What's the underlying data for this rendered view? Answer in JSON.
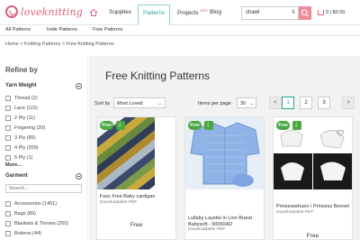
{
  "header": {
    "logo_text": "loveknitting",
    "nav": [
      "Supplies",
      "Patterns",
      "Projects",
      "Blog"
    ],
    "projects_badge": "NEW",
    "search_value": "shawl",
    "cart_text": "0 | $0.00",
    "brand_color": "#e0607e",
    "accent_color": "#2aa198"
  },
  "subnav": [
    "All Patterns",
    "Indie Patterns",
    "Free Patterns"
  ],
  "breadcrumb": "Home > Knitting Patterns > Free Knitting Patterns",
  "sidebar": {
    "refine_label": "Refine by",
    "yarn_weight_title": "Yarn Weight",
    "yarn_weights": [
      {
        "label": "Thread (2)"
      },
      {
        "label": "Lace (115)"
      },
      {
        "label": "2 Ply (11)"
      },
      {
        "label": "Fingering (20)"
      },
      {
        "label": "3 Ply (85)"
      },
      {
        "label": "4 Ply (209)"
      },
      {
        "label": "5 Ply (1)"
      }
    ],
    "more_label": "More...",
    "garment_title": "Garment",
    "garment_search_placeholder": "Search...",
    "garments": [
      {
        "label": "Accessories (1451)"
      },
      {
        "label": "Bags (89)"
      },
      {
        "label": "Blankets & Throws (250)"
      },
      {
        "label": "Boleros (44)"
      }
    ]
  },
  "main": {
    "title": "Free Knitting Patterns",
    "sort_label": "Sort by",
    "sort_value": "Most Loved",
    "ipp_label": "Items per page",
    "ipp_value": "30",
    "pages": [
      "1",
      "2",
      "3"
    ],
    "prev": "<",
    "next": ">"
  },
  "products": [
    {
      "badge": "Free",
      "title": "Fuss Free Baby cardigan",
      "subtitle": "Downloadable PDF",
      "price": "Free"
    },
    {
      "badge": "Free",
      "title": "Lullaby Layette in Lion Brand Babysoft - 90060AD",
      "subtitle": "Downloadable PDF",
      "price": ""
    },
    {
      "badge": "Free",
      "title": "Prinsessehuen / Princess Bonnet",
      "subtitle": "Downloadable PDF",
      "price": "Free"
    }
  ]
}
